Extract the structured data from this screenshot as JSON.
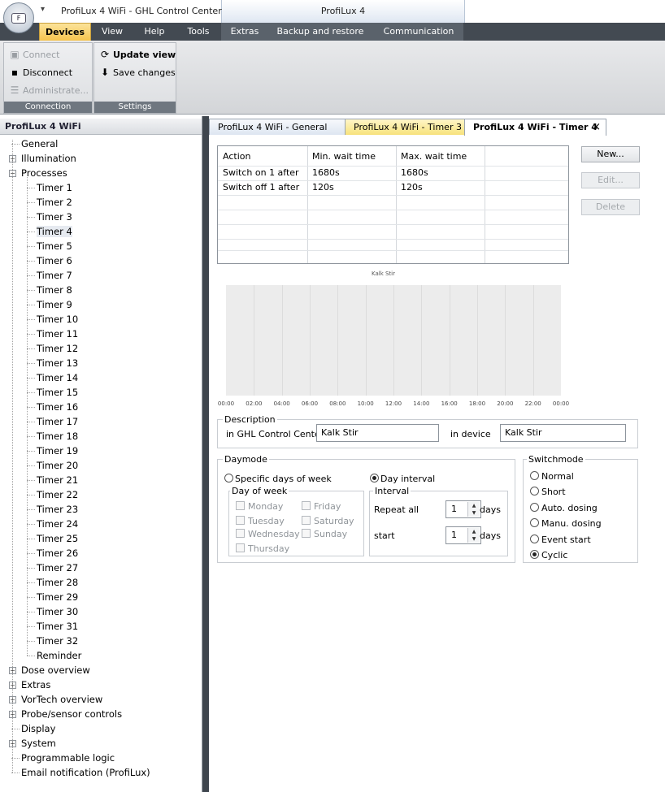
{
  "window": {
    "title": "ProfiLux 4 WiFi - GHL Control Center",
    "context_tab_title": "ProfiLux 4",
    "app_button_label": "F"
  },
  "menu": {
    "tabs": [
      "Devices",
      "View",
      "Help",
      "Tools",
      "Extras",
      "Backup and restore",
      "Communication"
    ],
    "active": "Devices"
  },
  "ribbon": {
    "connection": {
      "label": "Connection",
      "connect": "Connect",
      "disconnect": "Disconnect",
      "administrate": "Administrate..."
    },
    "settings": {
      "label": "Settings",
      "update_view": "Update view",
      "save_changes": "Save changes"
    }
  },
  "tree": {
    "header": "ProfiLux 4 WiFi",
    "top_items": [
      "General",
      "Illumination",
      "Processes"
    ],
    "process_children": [
      "Timer 1",
      "Timer 2",
      "Timer 3",
      "Timer 4",
      "Timer 5",
      "Timer 6",
      "Timer 7",
      "Timer 8",
      "Timer 9",
      "Timer 10",
      "Timer 11",
      "Timer 12",
      "Timer 13",
      "Timer 14",
      "Timer 15",
      "Timer 16",
      "Timer 17",
      "Timer 18",
      "Timer 19",
      "Timer 20",
      "Timer 21",
      "Timer 22",
      "Timer 23",
      "Timer 24",
      "Timer 25",
      "Timer 26",
      "Timer 27",
      "Timer 28",
      "Timer 29",
      "Timer 30",
      "Timer 31",
      "Timer 32",
      "Reminder"
    ],
    "bottom_items": [
      "Dose overview",
      "Extras",
      "VorTech overview",
      "Probe/sensor controls",
      "Display",
      "System",
      "Programmable logic",
      "Email notification (ProfiLux)"
    ],
    "selected": "Timer 4"
  },
  "doc_tabs": [
    "ProfiLux 4 WiFi - General",
    "ProfiLux 4 WiFi - Timer 3",
    "ProfiLux 4 WiFi - Timer 4"
  ],
  "close_glyph": "×",
  "table": {
    "headers": [
      "Action",
      "Min. wait time",
      "Max. wait time"
    ],
    "rows": [
      [
        "Switch on 1 after",
        "1680s",
        "1680s"
      ],
      [
        "Switch off 1 after",
        "120s",
        "120s"
      ]
    ]
  },
  "buttons": {
    "new": "New...",
    "edit": "Edit...",
    "delete": "Delete"
  },
  "chart": {
    "title": "Kalk Stir",
    "x_labels": [
      "00:00",
      "02:00",
      "04:00",
      "06:00",
      "08:00",
      "10:00",
      "12:00",
      "14:00",
      "16:00",
      "18:00",
      "20:00",
      "22:00",
      "00:00"
    ]
  },
  "description": {
    "legend": "Description",
    "gcc_label": "in GHL Control Center",
    "gcc_value": "Kalk Stir",
    "device_label": "in device",
    "device_value": "Kalk Stir"
  },
  "daymode": {
    "legend": "Daymode",
    "specific_days": "Specific days of week",
    "day_interval": "Day interval",
    "dow_legend": "Day of week",
    "days_col1": [
      "Monday",
      "Tuesday",
      "Wednesday",
      "Thursday"
    ],
    "days_col2": [
      "Friday",
      "Saturday",
      "Sunday"
    ],
    "interval_legend": "Interval",
    "repeat_label": "Repeat all",
    "repeat_value": "1",
    "start_label": "start",
    "start_value": "1",
    "unit": "days"
  },
  "switchmode": {
    "legend": "Switchmode",
    "options": [
      "Normal",
      "Short",
      "Auto. dosing",
      "Manu. dosing",
      "Event start",
      "Cyclic"
    ],
    "selected": "Cyclic"
  }
}
